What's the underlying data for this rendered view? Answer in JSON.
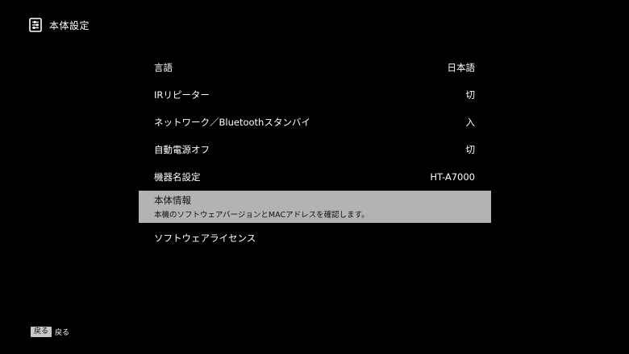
{
  "header": {
    "title": "本体設定",
    "icon": "settings-list-icon"
  },
  "menu": {
    "items": [
      {
        "label": "言語",
        "value": "日本語"
      },
      {
        "label": "IRリピーター",
        "value": "切"
      },
      {
        "label": "ネットワーク／Bluetoothスタンバイ",
        "value": "入"
      },
      {
        "label": "自動電源オフ",
        "value": "切"
      },
      {
        "label": "機器名設定",
        "value": "HT-A7000"
      },
      {
        "label": "本体情報",
        "description": "本機のソフトウェアバージョンとMACアドレスを確認します。",
        "selected": true
      },
      {
        "label": "ソフトウェアライセンス"
      }
    ]
  },
  "footer": {
    "key_label": "戻る",
    "action_label": "戻る"
  },
  "colors": {
    "background": "#000000",
    "text": "#ffffff",
    "selected_background": "#b3b3b3",
    "selected_text": "#111111"
  }
}
